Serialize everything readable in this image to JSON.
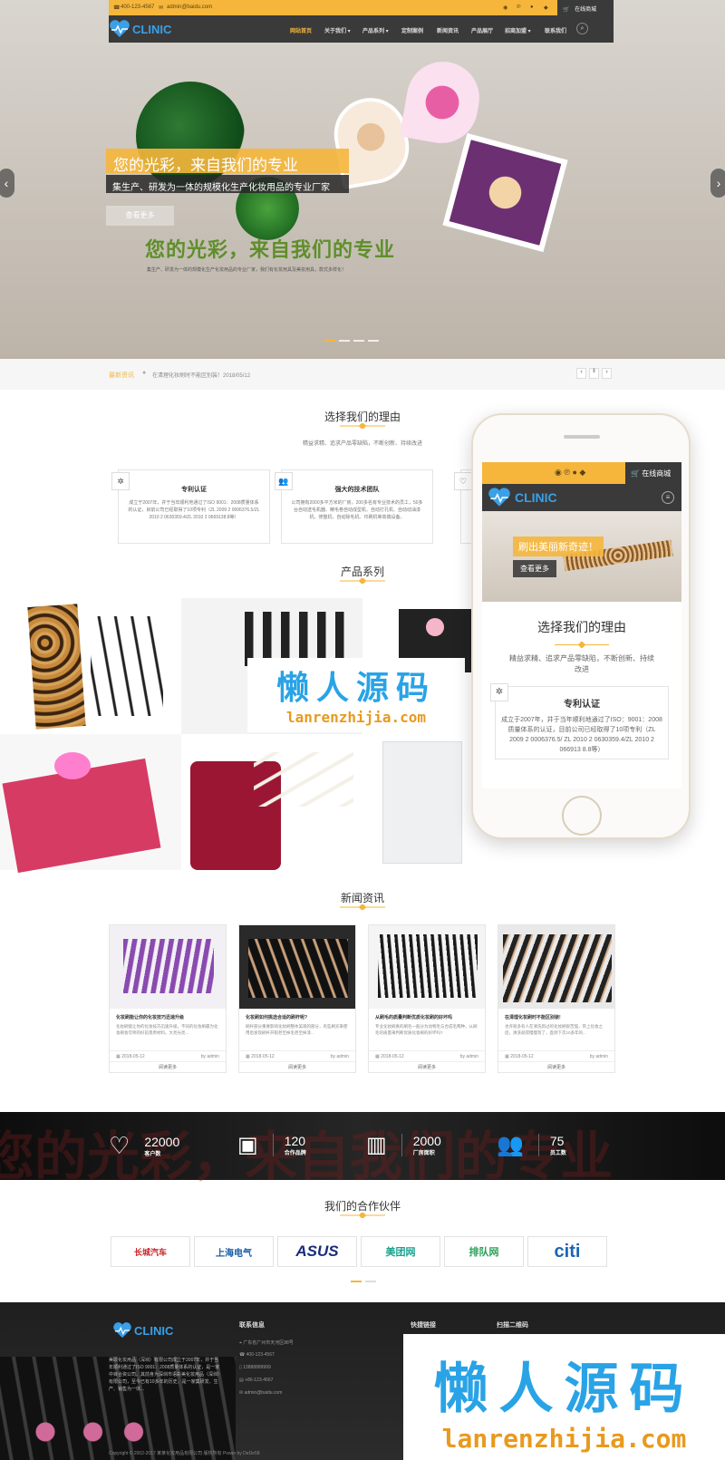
{
  "topbar": {
    "phone": "400-123-4567",
    "email": "admin@baidu.com",
    "shop": "在线商城"
  },
  "logo": "CLINIC",
  "nav": [
    "网站首页",
    "关于我们 ▾",
    "产品系列 ▾",
    "定制案例",
    "新闻资讯",
    "产品展厅",
    "招商加盟 ▾",
    "联系我们"
  ],
  "hero": {
    "title1": "您的光彩，来自我们的专业",
    "subtitle": "集生产、研发为一体的规模化生产化妆用品的专业厂家",
    "btn": "查看更多",
    "title2": "您的光彩，来自我们的专业",
    "desc": "集生产、研发为一体的规模化生产化妆用品的专业厂家，我们有化妆用具及美妆用具，款式多样化！"
  },
  "ticker": {
    "label": "最新资讯",
    "text": "在清理化妆刷时不能区别装！2018/05/12"
  },
  "reasons": {
    "title": "选择我们的理由",
    "tagline": "精益求精、追求产品零缺陷，不断创新、持续改进",
    "items": [
      {
        "title": "专利认证",
        "text": "成立于2007年，并于当年顺利地通过了ISO 9001：2008质量体系的认证，目前公司已经取得了10项专利（ZL 2009 2 0006376.5/ZL 2010 2 0630359.4/ZL 2010 2 0669138.8等）"
      },
      {
        "title": "强大的技术团队",
        "text": "公司拥有2000多平方米的厂房，200多名有专业技术的员工，50多台自动送毛机器、精毛卷自动成型机、自动打孔机、自动动油漆机、修整机、自动除毛机、印刷机等高端设备。"
      }
    ]
  },
  "products": {
    "title": "产品系列"
  },
  "watermark": {
    "cn": "懒人源码",
    "url": "lanrenzhijia.com"
  },
  "phone": {
    "shop": "在线商城",
    "logo": "CLINIC",
    "banner": "刷出美丽新奇迹！",
    "btn": "查看更多",
    "title": "选择我们的理由",
    "tagline": "精益求精、追求产品零缺陷，不断创新、持续改进",
    "card_title": "专利认证",
    "card_text": "成立于2007年，并于当年顺利地通过了ISO：9001：2008质量体系的认证，目前公司已经取得了10项专利（ZL 2009 2 0006376.5/ ZL 2010 2 0630359.4/ZL 2010 2 066913 8.8等）"
  },
  "news": {
    "title": "新闻资讯",
    "items": [
      {
        "title": "化妆刷能让你的化妆技巧迅速升级",
        "excerpt": "化妆刷能让你的化妆技巧迅速升级，不同的化妆刷最为化妆刷妆可师的好前景原材料。大亮光亮...",
        "date": "2018-05-12",
        "author": "by admin",
        "more": "阅读更多"
      },
      {
        "title": "化妆刷如何挑选合适的刷杆呢?",
        "excerpt": "刷杆部分重要影响化妆刷整体美观的部分，有些刷买来使用后发现刷杆开裂甚至掉毛甚至掉漆...",
        "date": "2018-05-12",
        "author": "by admin",
        "more": "阅读更多"
      },
      {
        "title": "从刷毛的质量判断优质化妆刷的好坏吗",
        "excerpt": "专业化妆刷真的刷毛一般分为动物毛与合成毛两种。从刷毛的质量来判断优质化妆刷的好坏吗?",
        "date": "2018-05-12",
        "author": "by admin",
        "more": "阅读更多"
      },
      {
        "title": "在清理化妆刷时不能区别装!",
        "excerpt": "也许很多有人在清洗到过的化妆刷很苦恼，带上化妆之后，清洗就得慢慢等了，直到下次10多年的...",
        "date": "2018-05-12",
        "author": "by admin",
        "more": "阅读更多"
      }
    ]
  },
  "stats": [
    {
      "n": "22000",
      "l": "客户数"
    },
    {
      "n": "120",
      "l": "合作品牌"
    },
    {
      "n": "2000",
      "l": "厂房面积"
    },
    {
      "n": "75",
      "l": "员工数"
    }
  ],
  "partners": {
    "title": "我们的合作伙伴",
    "items": [
      "长城汽车",
      "上海电气",
      "ASUS",
      "美团网",
      "排队网",
      "citi"
    ]
  },
  "footer": {
    "logo": "CLINIC",
    "about": "美颂化妆用品（深圳）有限公司成立于2007年，并于当年顺利通过了ISO 9001：2008质量体系的认证，是一家中目合资公司。其前身为深圳市语彩美化妆用品（深圳）有限公司，至今已有10多年的历史，是一家集研发、生产、销售为一体...",
    "contact_title": "联系信息",
    "addr": "广东省广州市天河区88号",
    "tel": "400-123-4567",
    "mobile": "13888889999",
    "fax": "+86-123-4567",
    "mail": "admin@baidu.com",
    "links_title": "快捷链接",
    "qr_title": "扫描二维码",
    "copyright": "Copyright © 2002-2017 某某化妆用品有限公司 版权所有 Power by DeDe58"
  }
}
